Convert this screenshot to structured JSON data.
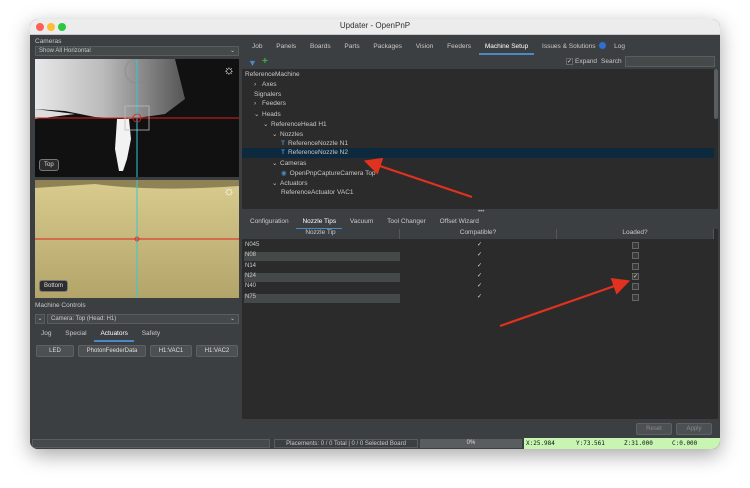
{
  "window": {
    "title": "Updater - OpenPnP"
  },
  "cameras_panel": {
    "title": "Cameras",
    "view_select": "Show All Horizontal",
    "top_label": "Top",
    "bottom_label": "Bottom"
  },
  "machine_controls": {
    "title": "Machine Controls",
    "camera_select": "Camera: Top (Head: H1)",
    "tabs": [
      "Jog",
      "Special",
      "Actuators",
      "Safety"
    ],
    "active_tab": "Actuators",
    "buttons": [
      "LED",
      "PhotonFeederData",
      "H1:VAC1",
      "H1:VAC2"
    ]
  },
  "main_tabs": [
    "Job",
    "Panels",
    "Boards",
    "Parts",
    "Packages",
    "Vision",
    "Feeders",
    "Machine Setup",
    "Issues & Solutions",
    "Log"
  ],
  "active_main_tab": "Machine Setup",
  "toolbar": {
    "expand_label": "Expand",
    "search_label": "Search",
    "expand_checked": true
  },
  "tree": [
    {
      "label": "ReferenceMachine",
      "depth": 0,
      "arrow": ""
    },
    {
      "label": "Axes",
      "depth": 1,
      "arrow": "›"
    },
    {
      "label": "Signalers",
      "depth": 1,
      "arrow": ""
    },
    {
      "label": "Feeders",
      "depth": 1,
      "arrow": "›"
    },
    {
      "label": "Heads",
      "depth": 1,
      "arrow": "⌄"
    },
    {
      "label": "ReferenceHead H1",
      "depth": 2,
      "arrow": "⌄"
    },
    {
      "label": "Nozzles",
      "depth": 3,
      "arrow": "⌄"
    },
    {
      "label": "ReferenceNozzle N1",
      "depth": 4,
      "arrow": ""
    },
    {
      "label": "ReferenceNozzle N2",
      "depth": 4,
      "arrow": "",
      "selected": true
    },
    {
      "label": "Cameras",
      "depth": 3,
      "arrow": "⌄"
    },
    {
      "label": "OpenPnpCaptureCamera Top",
      "depth": 4,
      "arrow": ""
    },
    {
      "label": "Actuators",
      "depth": 3,
      "arrow": "⌄"
    },
    {
      "label": "ReferenceActuator VAC1",
      "depth": 4,
      "arrow": ""
    }
  ],
  "detail_tabs": [
    "Configuration",
    "Nozzle Tips",
    "Vacuum",
    "Tool Changer",
    "Offset Wizard"
  ],
  "active_detail_tab": "Nozzle Tips",
  "nozzle_table": {
    "headers": [
      "Nozzle Tip",
      "Compatible?",
      "Loaded?"
    ],
    "rows": [
      {
        "tip": "N045",
        "compatible": true,
        "loaded": false
      },
      {
        "tip": "N08",
        "compatible": true,
        "loaded": false
      },
      {
        "tip": "N14",
        "compatible": true,
        "loaded": false
      },
      {
        "tip": "N24",
        "compatible": true,
        "loaded": true
      },
      {
        "tip": "N40",
        "compatible": true,
        "loaded": false
      },
      {
        "tip": "N75",
        "compatible": true,
        "loaded": false
      }
    ]
  },
  "actions": {
    "reset": "Reset",
    "apply": "Apply"
  },
  "status_bar": {
    "placements": "Placements: 0 / 0 Total | 0 / 0 Selected Board",
    "progress": "0%",
    "x": "X:25.984",
    "y": "Y:73.561",
    "z": "Z:31.000",
    "c": "C:0.000"
  },
  "colors": {
    "accent": "#4a88c7",
    "arrow": "#e0321e",
    "dro_bg": "#c9f5b3"
  }
}
